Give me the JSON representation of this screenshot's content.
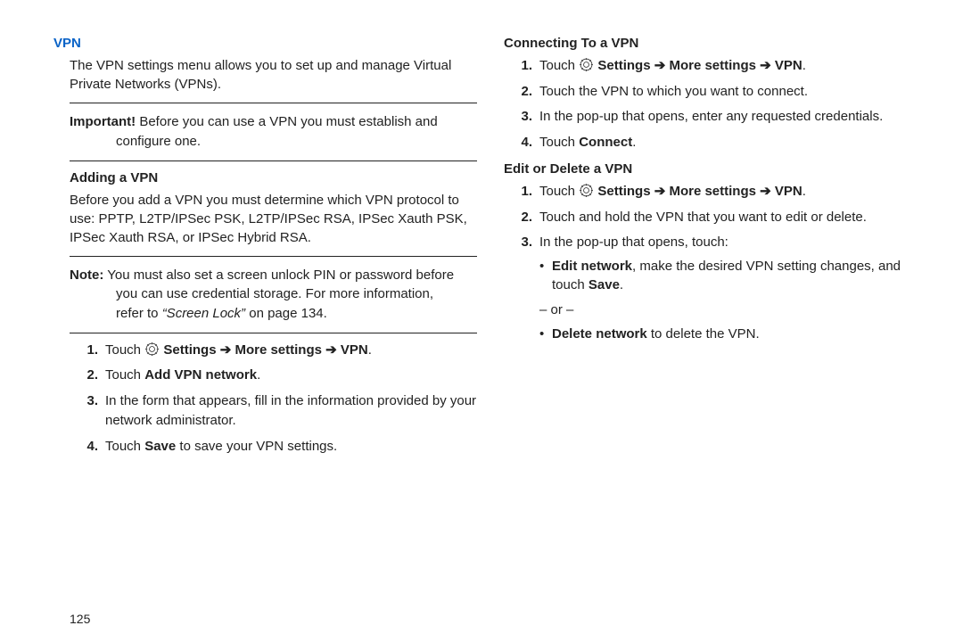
{
  "left": {
    "heading": "VPN",
    "intro": "The VPN settings menu allows you to set up and manage Virtual Private Networks (VPNs).",
    "important_label": "Important!",
    "important_text": " Before you can use a VPN you must establish and configure one.",
    "adding_head": "Adding a VPN",
    "adding_para": "Before you add a VPN you must determine which VPN protocol to use: PPTP, L2TP/IPSec PSK, L2TP/IPSec RSA, IPSec Xauth PSK, IPSec Xauth RSA, or IPSec Hybrid RSA.",
    "note_label": "Note:",
    "note_text_a": " You must also set a screen unlock PIN or password before you can use credential storage. For more information, refer to ",
    "note_ref": "“Screen Lock”",
    "note_text_b": " on page 134.",
    "steps": {
      "s1_touch": "Touch ",
      "s1_path": " Settings ➔ More settings ➔ VPN",
      "s2_a": "Touch ",
      "s2_b": "Add VPN network",
      "s3": "In the form that appears, fill in the information provided by your network administrator.",
      "s4_a": "Touch ",
      "s4_b": "Save",
      "s4_c": " to save your VPN settings."
    }
  },
  "right": {
    "connect_head": "Connecting To a VPN",
    "c1_touch": "Touch ",
    "c1_path": " Settings ➔ More settings ➔ VPN",
    "c2": "Touch the VPN to which you want to connect.",
    "c3": "In the pop-up that opens, enter any requested credentials.",
    "c4_a": "Touch ",
    "c4_b": "Connect",
    "edit_head": "Edit or Delete a VPN",
    "e1_touch": "Touch ",
    "e1_path": " Settings ➔ More settings ➔ VPN",
    "e2": "Touch and hold the VPN that you want to edit or delete.",
    "e3": "In the pop-up that opens, touch:",
    "bullet1_a": "Edit network",
    "bullet1_b": ", make the desired VPN setting changes, and touch ",
    "bullet1_c": "Save",
    "or": "– or –",
    "bullet2_a": "Delete network",
    "bullet2_b": " to delete the VPN."
  },
  "page_num": "125",
  "labels": {
    "n1": "1.",
    "n2": "2.",
    "n3": "3.",
    "n4": "4."
  }
}
